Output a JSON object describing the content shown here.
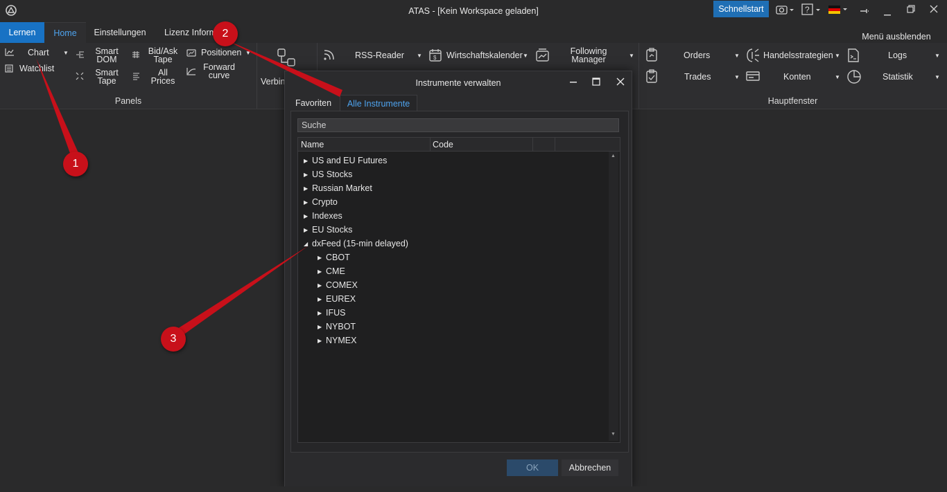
{
  "titlebar": {
    "title": "ATAS - [Kein Workspace geladen]",
    "quick_start": "Schnellstart",
    "icons": [
      "atas-logo-icon",
      "camera-icon",
      "help-icon",
      "flag-de-icon",
      "pin-icon",
      "minimize-icon",
      "maximize-icon",
      "close-icon"
    ]
  },
  "menu": {
    "tabs": [
      "Lernen",
      "Home",
      "Einstellungen",
      "Lizenz Inform"
    ],
    "hide_menu": "Menü ausblenden"
  },
  "ribbon": {
    "panels": {
      "chart": "Chart",
      "watchlist": "Watchlist",
      "smart_dom_1": "Smart",
      "smart_dom_2": "DOM",
      "smart_tape_1": "Smart",
      "smart_tape_2": "Tape",
      "bidask_1": "Bid/Ask",
      "bidask_2": "Tape",
      "allprices_1": "All",
      "allprices_2": "Prices",
      "positionen": "Positionen",
      "forward_1": "Forward",
      "forward_2": "curve",
      "group": "Panels"
    },
    "verbind": "Verbin",
    "rss": "RSS-Reader",
    "calendar": "Wirtschaftskalender",
    "following_1": "Following",
    "following_2": "Manager",
    "orders": "Orders",
    "trades": "Trades",
    "strategies": "Handelsstrategien",
    "accounts": "Konten",
    "logs": "Logs",
    "stats": "Statistik",
    "main_group": "Hauptfenster"
  },
  "dialog": {
    "title": "Instrumente verwalten",
    "tabs": [
      "Favoriten",
      "Alle Instrumente"
    ],
    "search_placeholder": "Suche",
    "columns": [
      "Name",
      "Code"
    ],
    "tree": [
      {
        "label": "US and EU Futures",
        "level": 0,
        "expanded": false
      },
      {
        "label": "US Stocks",
        "level": 0,
        "expanded": false
      },
      {
        "label": "Russian Market",
        "level": 0,
        "expanded": false
      },
      {
        "label": "Crypto",
        "level": 0,
        "expanded": false
      },
      {
        "label": "Indexes",
        "level": 0,
        "expanded": false
      },
      {
        "label": "EU Stocks",
        "level": 0,
        "expanded": false
      },
      {
        "label": "dxFeed (15-min delayed)",
        "level": 0,
        "expanded": true
      },
      {
        "label": "CBOT",
        "level": 1,
        "expanded": false
      },
      {
        "label": "CME",
        "level": 1,
        "expanded": false
      },
      {
        "label": "COMEX",
        "level": 1,
        "expanded": false
      },
      {
        "label": "EUREX",
        "level": 1,
        "expanded": false
      },
      {
        "label": "IFUS",
        "level": 1,
        "expanded": false
      },
      {
        "label": "NYBOT",
        "level": 1,
        "expanded": false
      },
      {
        "label": "NYMEX",
        "level": 1,
        "expanded": false
      }
    ],
    "ok": "OK",
    "cancel": "Abbrechen"
  },
  "annotations": [
    "1",
    "2",
    "3"
  ],
  "colors": {
    "accent": "#1872c4",
    "marker": "#c8101a",
    "active_tab_text": "#4ea3ee"
  }
}
